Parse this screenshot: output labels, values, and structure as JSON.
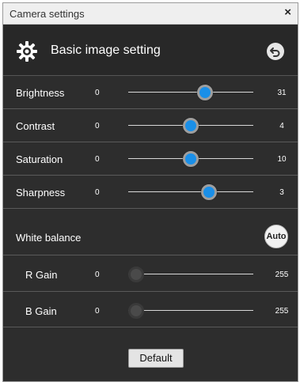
{
  "window": {
    "title": "Camera settings",
    "close_glyph": "×"
  },
  "header": {
    "title": "Basic image setting",
    "icon": "gear-icon",
    "back_icon": "undo-icon"
  },
  "sliders": [
    {
      "label": "Brightness",
      "min": "0",
      "max": "31",
      "value_fraction": 0.63,
      "enabled": true
    },
    {
      "label": "Contrast",
      "min": "0",
      "max": "4",
      "value_fraction": 0.5,
      "enabled": true
    },
    {
      "label": "Saturation",
      "min": "0",
      "max": "10",
      "value_fraction": 0.5,
      "enabled": true
    },
    {
      "label": "Sharpness",
      "min": "0",
      "max": "3",
      "value_fraction": 0.67,
      "enabled": true
    }
  ],
  "white_balance": {
    "label": "White balance",
    "auto_label": "Auto",
    "gains": [
      {
        "label": "R Gain",
        "min": "0",
        "max": "255",
        "value_fraction": 0.0,
        "enabled": false
      },
      {
        "label": "B Gain",
        "min": "0",
        "max": "255",
        "value_fraction": 0.0,
        "enabled": false
      }
    ]
  },
  "footer": {
    "default_label": "Default"
  },
  "colors": {
    "thumb_active": "#1a8fe8",
    "panel_bg": "#2d2d2d"
  }
}
